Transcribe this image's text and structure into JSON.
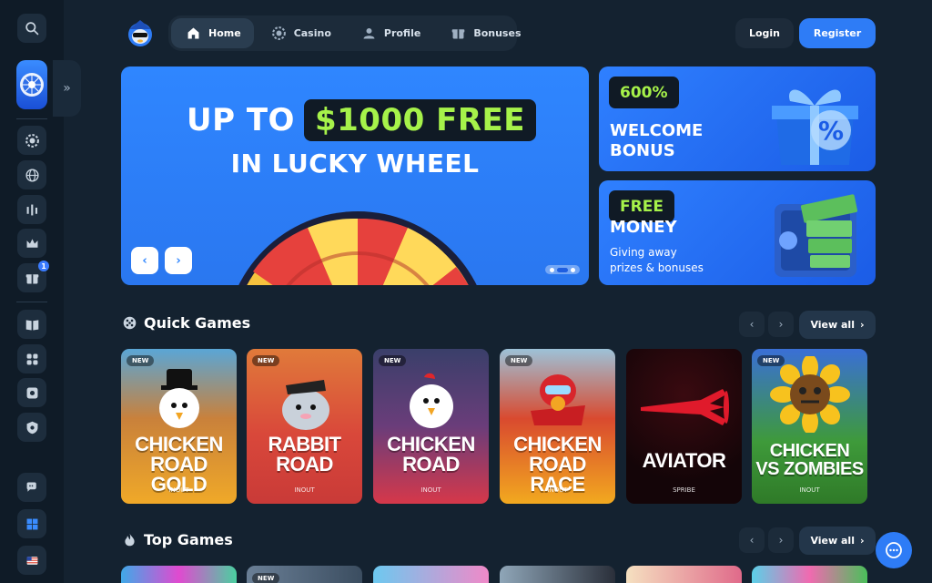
{
  "sidebar": {
    "icons": [
      "search-icon",
      "lucky-wheel-icon",
      "expand-icon",
      "casino-chip-icon",
      "globe-icon",
      "live-stats-icon",
      "crown-icon",
      "gift-icon",
      "book-icon",
      "games-icon",
      "safe-icon",
      "shield-icon",
      "chat-bubbles-icon",
      "windows-icon",
      "us-flag-icon"
    ],
    "gift_badge": "1"
  },
  "header": {
    "nav": [
      {
        "label": "Home",
        "icon": "home-icon",
        "active": true
      },
      {
        "label": "Casino",
        "icon": "casino-chip-icon",
        "active": false
      },
      {
        "label": "Profile",
        "icon": "user-icon",
        "active": false
      },
      {
        "label": "Bonuses",
        "icon": "gift-icon",
        "active": false
      }
    ],
    "login_label": "Login",
    "register_label": "Register"
  },
  "hero": {
    "line1_prefix": "UP TO",
    "line1_highlight": "$1000 FREE",
    "line2": "IN LUCKY WHEEL",
    "prev_label": "‹",
    "next_label": "›"
  },
  "promos": [
    {
      "tag": "600%",
      "title_1": "WELCOME",
      "title_2": "BONUS"
    },
    {
      "tag": "FREE",
      "title_1": "MONEY",
      "sub_1": "Giving away",
      "sub_2": "prizes & bonuses"
    }
  ],
  "quick_games": {
    "title": "Quick Games",
    "view_all": "View all",
    "games": [
      {
        "title": "CHICKEN\nROAD GOLD",
        "provider": "INOUT",
        "new": "NEW"
      },
      {
        "title": "RABBIT\nROAD",
        "provider": "INOUT",
        "new": "NEW"
      },
      {
        "title": "CHICKEN\nROAD",
        "provider": "INOUT",
        "new": "NEW"
      },
      {
        "title": "CHICKEN\nROAD RACE",
        "provider": "INOUT",
        "new": "NEW"
      },
      {
        "title": "AVIATOR",
        "provider": "SPRIBE",
        "new": ""
      },
      {
        "title": "CHICKEN\nVS ZOMBIES",
        "provider": "INOUT",
        "new": "NEW"
      }
    ]
  },
  "top_games": {
    "title": "Top Games",
    "view_all": "View all",
    "second_card_new": "NEW"
  },
  "colors": {
    "accent": "#2e7cf6",
    "highlight_green": "#a6f24a",
    "background": "#142230"
  }
}
